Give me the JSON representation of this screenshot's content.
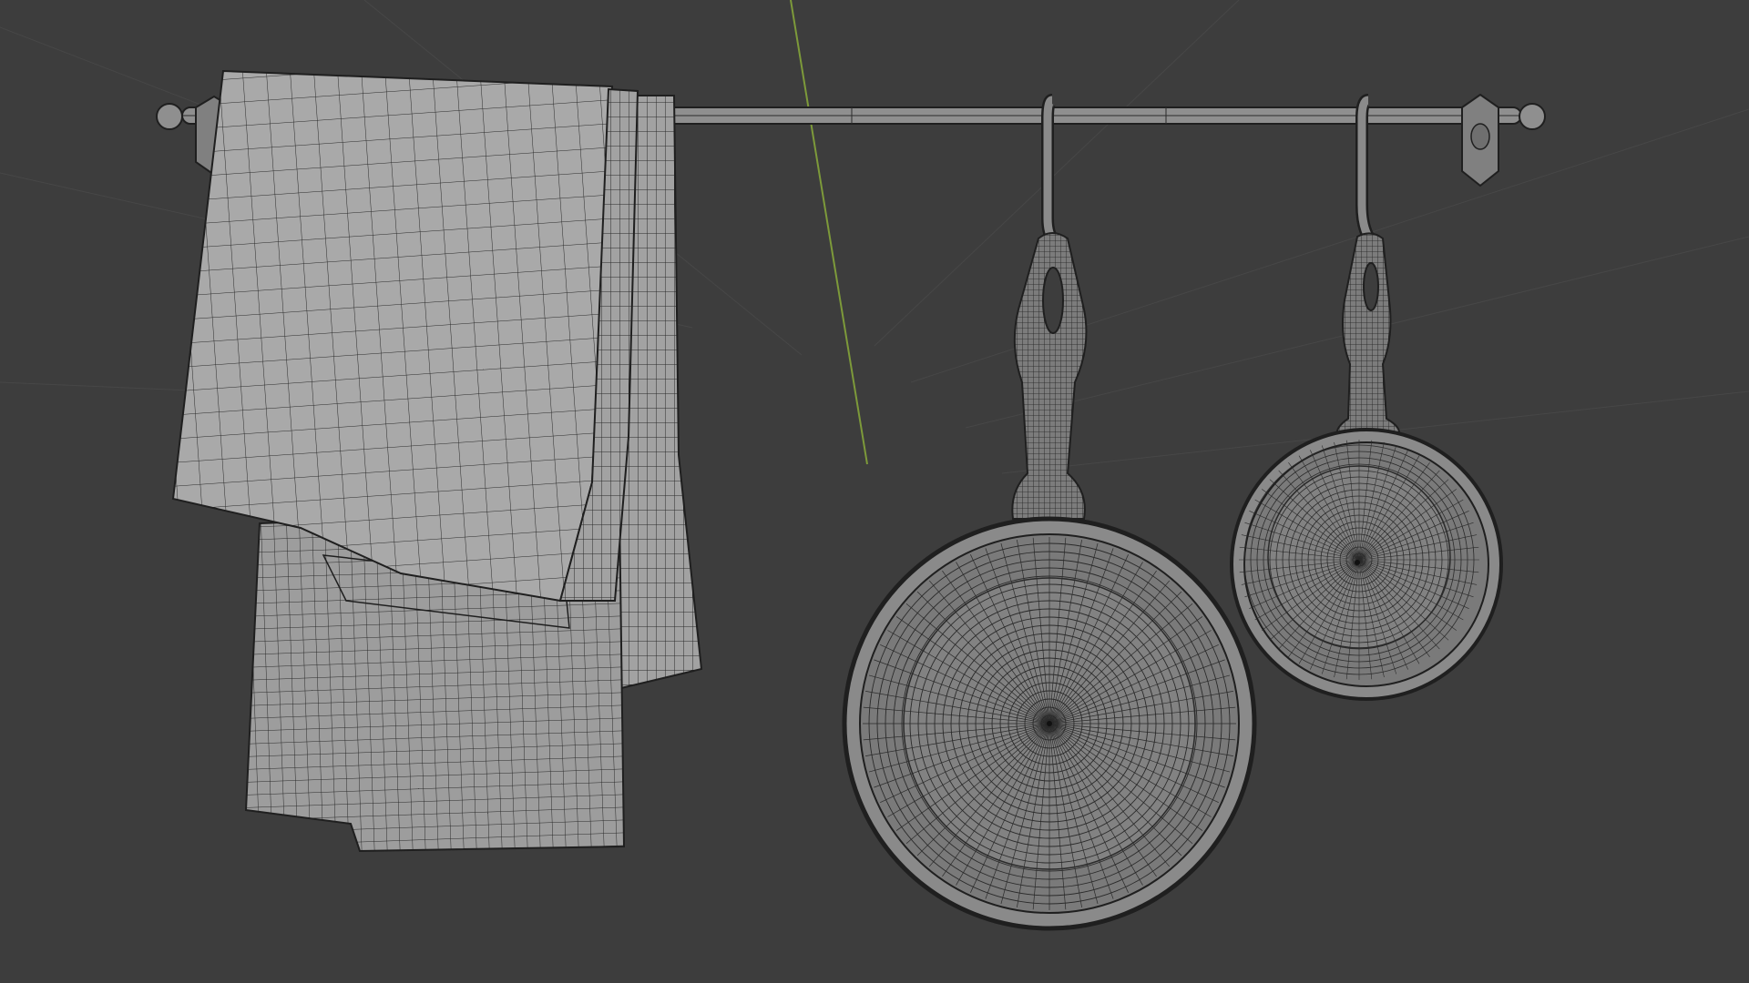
{
  "viewport": {
    "background_color": "#3d3d3d",
    "wire_color": "#1f1f1f",
    "mesh_fill_color": "#a6a6a6",
    "pan_fill_color": "#8a8a8a",
    "grid_line_color": "#4a4a4a",
    "y_axis_color": "#7d9a3a"
  },
  "objects": [
    {
      "name": "wall-rail",
      "kind": "rail"
    },
    {
      "name": "kitchen-towel",
      "kind": "cloth"
    },
    {
      "name": "rail-hook-left",
      "kind": "hook"
    },
    {
      "name": "rail-hook-right",
      "kind": "hook"
    },
    {
      "name": "frying-pan-large",
      "kind": "pan"
    },
    {
      "name": "frying-pan-small",
      "kind": "pan"
    }
  ]
}
